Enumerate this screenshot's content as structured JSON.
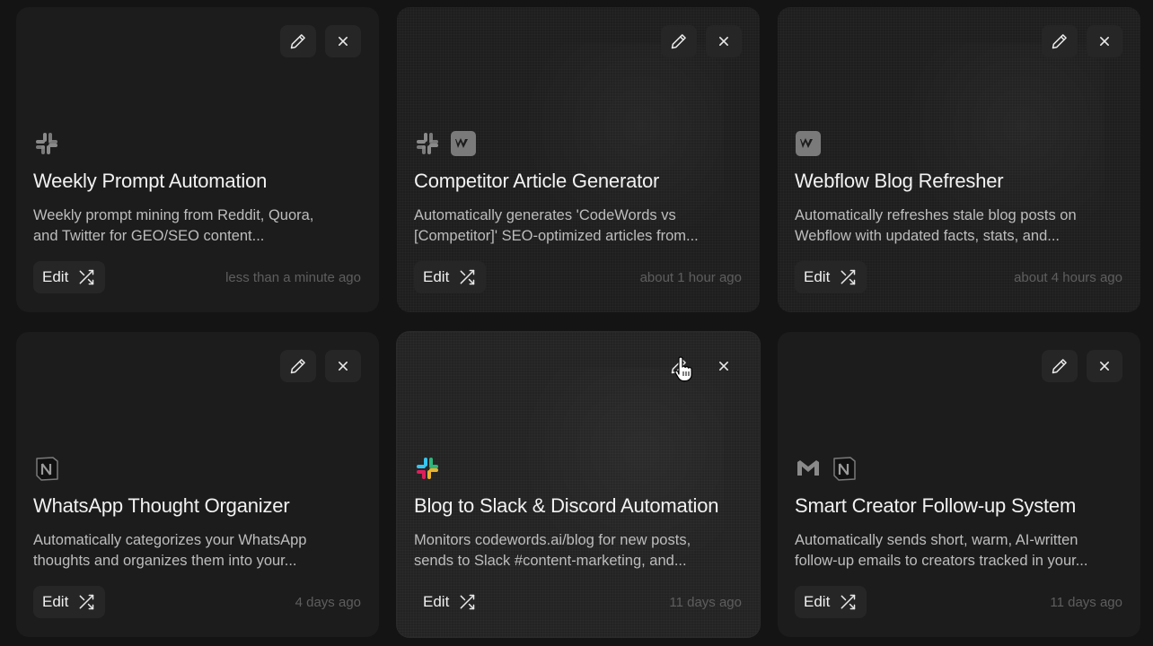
{
  "cards": [
    {
      "title": "Weekly Prompt Automation",
      "desc_line1": "Weekly prompt mining from Reddit, Quora,",
      "desc_line2": "and Twitter for GEO/SEO content...",
      "edit_label": "Edit",
      "time": "less than a minute ago",
      "logos": [
        "slack-mono-icon"
      ]
    },
    {
      "title": "Competitor Article Generator",
      "desc_line1": "Automatically generates 'CodeWords vs",
      "desc_line2": "[Competitor]' SEO-optimized articles from...",
      "edit_label": "Edit",
      "time": "about 1 hour ago",
      "logos": [
        "slack-mono-icon",
        "webflow-icon"
      ]
    },
    {
      "title": "Webflow Blog Refresher",
      "desc_line1": "Automatically refreshes stale blog posts on",
      "desc_line2": "Webflow with updated facts, stats, and...",
      "edit_label": "Edit",
      "time": "about 4 hours ago",
      "logos": [
        "webflow-icon"
      ]
    },
    {
      "title": "WhatsApp Thought Organizer",
      "desc_line1": "Automatically categorizes your WhatsApp",
      "desc_line2": "thoughts and organizes them into your...",
      "edit_label": "Edit",
      "time": "4 days ago",
      "logos": [
        "notion-icon"
      ]
    },
    {
      "title": "Blog to Slack & Discord Automation",
      "desc_line1": "Monitors codewords.ai/blog for new posts,",
      "desc_line2": "sends to Slack #content-marketing, and...",
      "edit_label": "Edit",
      "time": "11 days ago",
      "logos": [
        "slack-color-icon"
      ]
    },
    {
      "title": "Smart Creator Follow-up System",
      "desc_line1": "Automatically sends short, warm, AI-written",
      "desc_line2": "follow-up emails to creators tracked in your...",
      "edit_label": "Edit",
      "time": "11 days ago",
      "logos": [
        "gmail-mono-icon",
        "notion-icon"
      ]
    }
  ],
  "colors": {
    "background": "#141414",
    "card": "#1c1c1c",
    "title": "#f2f2f2",
    "desc": "#bdbdbd",
    "time": "#5e5e5e"
  }
}
